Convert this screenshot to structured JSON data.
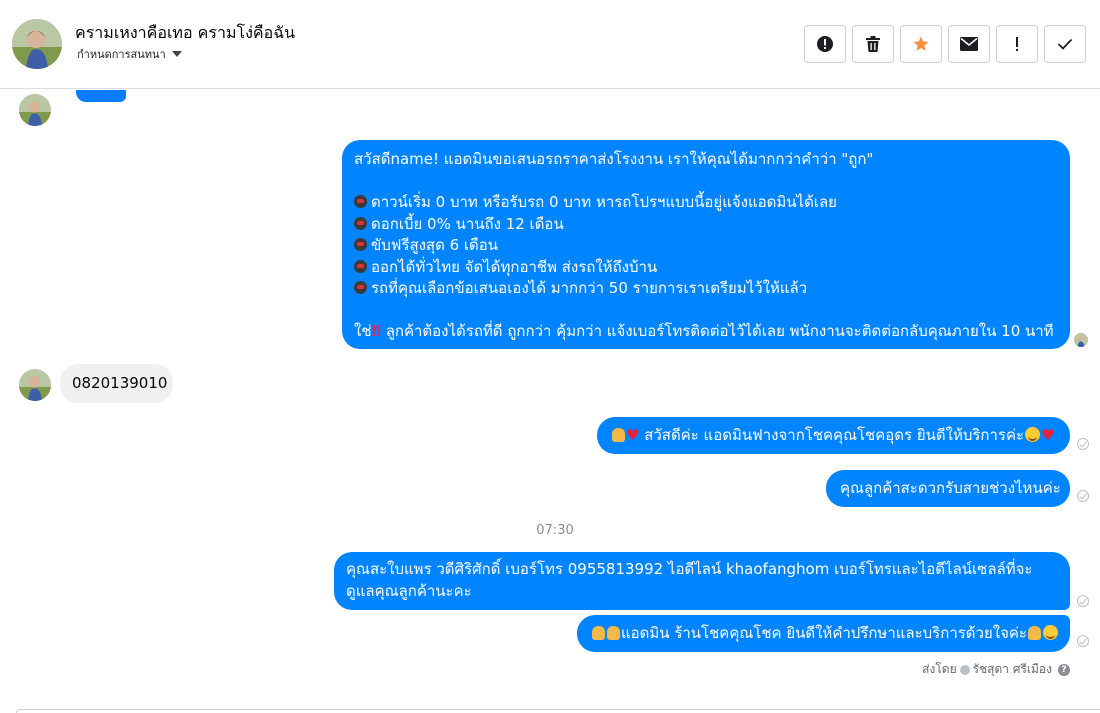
{
  "header": {
    "contact_name": "ครามเหงาคือเทอ ครามโง่คือฉัน",
    "subtitle": "กำหนดการสนทนา",
    "toolbar": [
      {
        "icon": "alert-circle-icon",
        "label": "Mark as spam"
      },
      {
        "icon": "trash-icon",
        "label": "Delete"
      },
      {
        "icon": "star-icon",
        "label": "Star"
      },
      {
        "icon": "envelope-icon",
        "label": "Mark unread"
      },
      {
        "icon": "exclamation-icon",
        "label": "Follow up"
      },
      {
        "icon": "check-icon",
        "label": "Done"
      }
    ],
    "star_color": "#f5913e"
  },
  "messages": {
    "main_offer": {
      "line1": "สวัสดีname! แอดมินขอเสนอรถราคาส่งโรงงาน เราให้คุณได้มากกว่าคำว่า \"ถูก\"",
      "line2": "ดาวน์เริ่ม 0 บาท หรือรับรถ 0 บาท หารถโปรฯแบบนี้อยู่แจ้งแอดมินได้เลย",
      "line3": "ดอกเบี้ย 0% นานถึง 12 เดือน",
      "line4": "ขับฟรีสูงสุด 6 เดือน",
      "line5": "ออกได้ทั่วไทย จัดได้ทุกอาชีพ ส่งรถให้ถึงบ้าน",
      "line6": "รถที่คุณเลือกข้อเสนอเองได้ มากกว่า 50 รายการเราเตรียมไว้ให้แล้ว",
      "line7_prefix": "ใช่",
      "line7_suffix": " ลูกค้าต้องได้รถที่ดี ถูกกว่า คุ้มกว่า แจ้งเบอร์โทรติดต่อไว้ได้เลย พนักงานจะติดต่อกลับคุณภายใน 10 นาที"
    },
    "customer_phone": "0820139010",
    "greeting": " สวัสดีค่ะ แอดมินฟางจากโชคคุณโชคอุดร ยินดีให้บริการค่ะ",
    "ask_time": "คุณลูกค้าสะดวกรับสายช่วงไหนค่ะ",
    "timestamp": "07:30",
    "staff_info": "คุณสะใบแพร วดีศิริศักดิ์ เบอร์โทร 0955813992  ไอดีไลน์  khaofanghom   เบอร์โทรและไอดีไลน์เซลล์ที่จะดูแลคุณลูกค้านะคะ",
    "admin_closing": "แอดมิน ร้านโชคคุณโชค ยินดีให้คำปรึกษาและบริการด้วยใจค่ะ"
  },
  "footer": {
    "sent_by_label": "ส่งโดย",
    "sender_name": "รัชสุดา ศรีเมือง"
  },
  "colors": {
    "outgoing_bubble": "#0084ff",
    "incoming_bubble": "#f0f0f0"
  }
}
